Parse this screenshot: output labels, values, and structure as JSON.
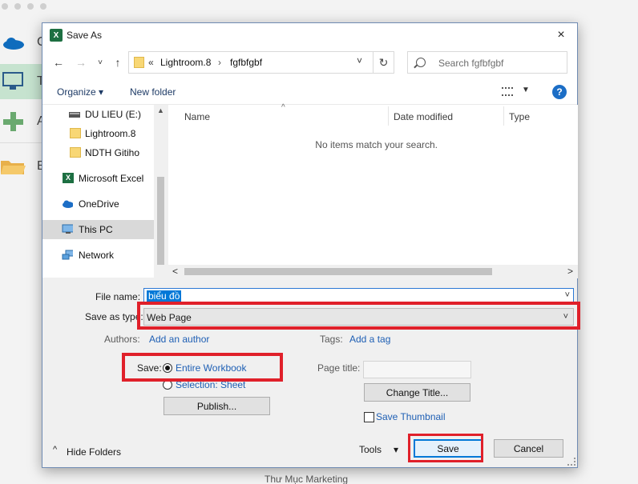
{
  "window": {
    "title": "Save As",
    "close_icon": "×"
  },
  "background": {
    "menu_letters": [
      "C",
      "T",
      "A",
      "B"
    ],
    "bottom_text": "Thư Mục Marketing"
  },
  "navbar": {
    "back_icon": "←",
    "forward_icon": "→",
    "recent_icon": "˅",
    "up_icon": "↑",
    "address": {
      "chevron": "«",
      "segments": [
        "Lightroom.8",
        "fgfbfgbf"
      ],
      "separator": "›",
      "dropdown_icon": "˅"
    },
    "refresh_icon": "↻",
    "search_placeholder": "Search fgfbfgbf"
  },
  "toolbar": {
    "organize_label": "Organize ▾",
    "new_folder_label": "New folder",
    "view_dd_icon": "▼",
    "help_icon": "?"
  },
  "nav_pane": {
    "items": [
      {
        "label": "DU LIEU (E:)",
        "icon": "drive-icon"
      },
      {
        "label": "Lightroom.8",
        "icon": "folder-icon"
      },
      {
        "label": "NDTH Gitiho",
        "icon": "folder-icon"
      },
      {
        "label": "Microsoft Excel",
        "icon": "excel-icon"
      },
      {
        "label": "OneDrive",
        "icon": "cloud-icon"
      },
      {
        "label": "This PC",
        "icon": "pc-icon",
        "selected": true
      },
      {
        "label": "Network",
        "icon": "network-icon"
      }
    ]
  },
  "file_pane": {
    "columns": [
      "Name",
      "Date modified",
      "Type"
    ],
    "sort_icon": "^",
    "empty_message": "No items match your search."
  },
  "scrollbar": {
    "up": "▲",
    "down": "▼",
    "left": "<",
    "right": ">"
  },
  "form": {
    "file_name_label": "File name:",
    "file_name_value": "biểu đồ",
    "save_as_type_label": "Save as type:",
    "save_as_type_value": "Web Page",
    "dropdown_icon": "˅",
    "authors_label": "Authors:",
    "authors_link": "Add an author",
    "tags_label": "Tags:",
    "tags_link": "Add a tag",
    "save_label": "Save:",
    "save_options": [
      "Entire Workbook",
      "Selection: Sheet"
    ],
    "publish_button": "Publish...",
    "page_title_label": "Page title:",
    "change_title_button": "Change Title...",
    "save_thumbnail_label": "Save Thumbnail"
  },
  "footer": {
    "hide_folders": "Hide Folders",
    "hide_icon": "^",
    "tools": "Tools",
    "tools_dd": "▾",
    "save_button": "Save",
    "cancel_button": "Cancel"
  },
  "colors": {
    "accent": "#0078d7",
    "highlight_box": "#e0202a",
    "excel_green": "#1d6f42"
  }
}
